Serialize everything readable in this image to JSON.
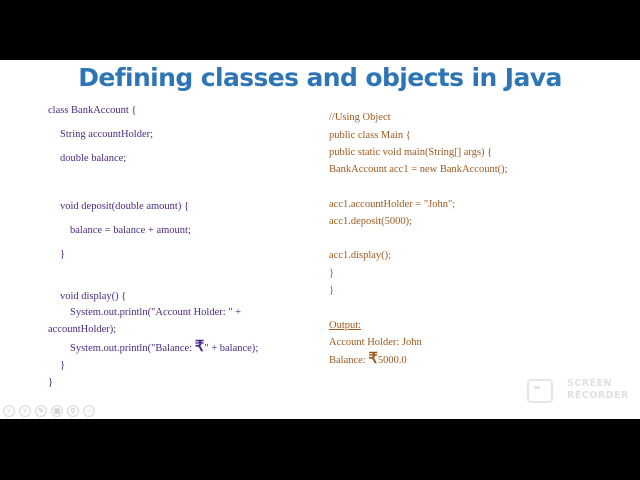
{
  "slide": {
    "title": "Defining classes and objects in Java",
    "class_code": {
      "l1": "class BankAccount {",
      "l2": "String accountHolder;",
      "l3": "double balance;",
      "l4": "void deposit(double amount) {",
      "l5": "balance = balance + amount;",
      "l6": "}",
      "l7": "void display() {",
      "l8a": "System.out.println(\"Account Holder: \" +",
      "l8b": "accountHolder);",
      "l9_before": "System.out.println(\"Balance: ",
      "l9_rupee": "₹",
      "l9_after": "\" + balance);",
      "l10": "}",
      "l11": "}"
    },
    "main_code": {
      "r1": "//Using Object",
      "r2": "public class Main {",
      "r3": "public static void main(String[] args) {",
      "r4": "BankAccount acc1 = new BankAccount();",
      "r5": "acc1.accountHolder = \"John\";",
      "r6": "acc1.deposit(5000);",
      "r7": "acc1.display();",
      "r8": "}",
      "r9": "}"
    },
    "output": {
      "label": "Output:",
      "line1": "Account Holder: John",
      "rupee": "₹",
      "line2_value": "5000.0",
      "line2_prefix": "Balance: "
    },
    "colors": {
      "title": "#2e75b6",
      "class_code": "#4b2a86",
      "main_code": "#a0581c"
    }
  },
  "toolbar": {
    "icons": [
      "previous-icon",
      "next-icon",
      "pen-icon",
      "slides-icon",
      "zoom-icon",
      "more-icon"
    ]
  },
  "watermark": {
    "line1": "SCREEN",
    "line2": "RECORDER"
  }
}
